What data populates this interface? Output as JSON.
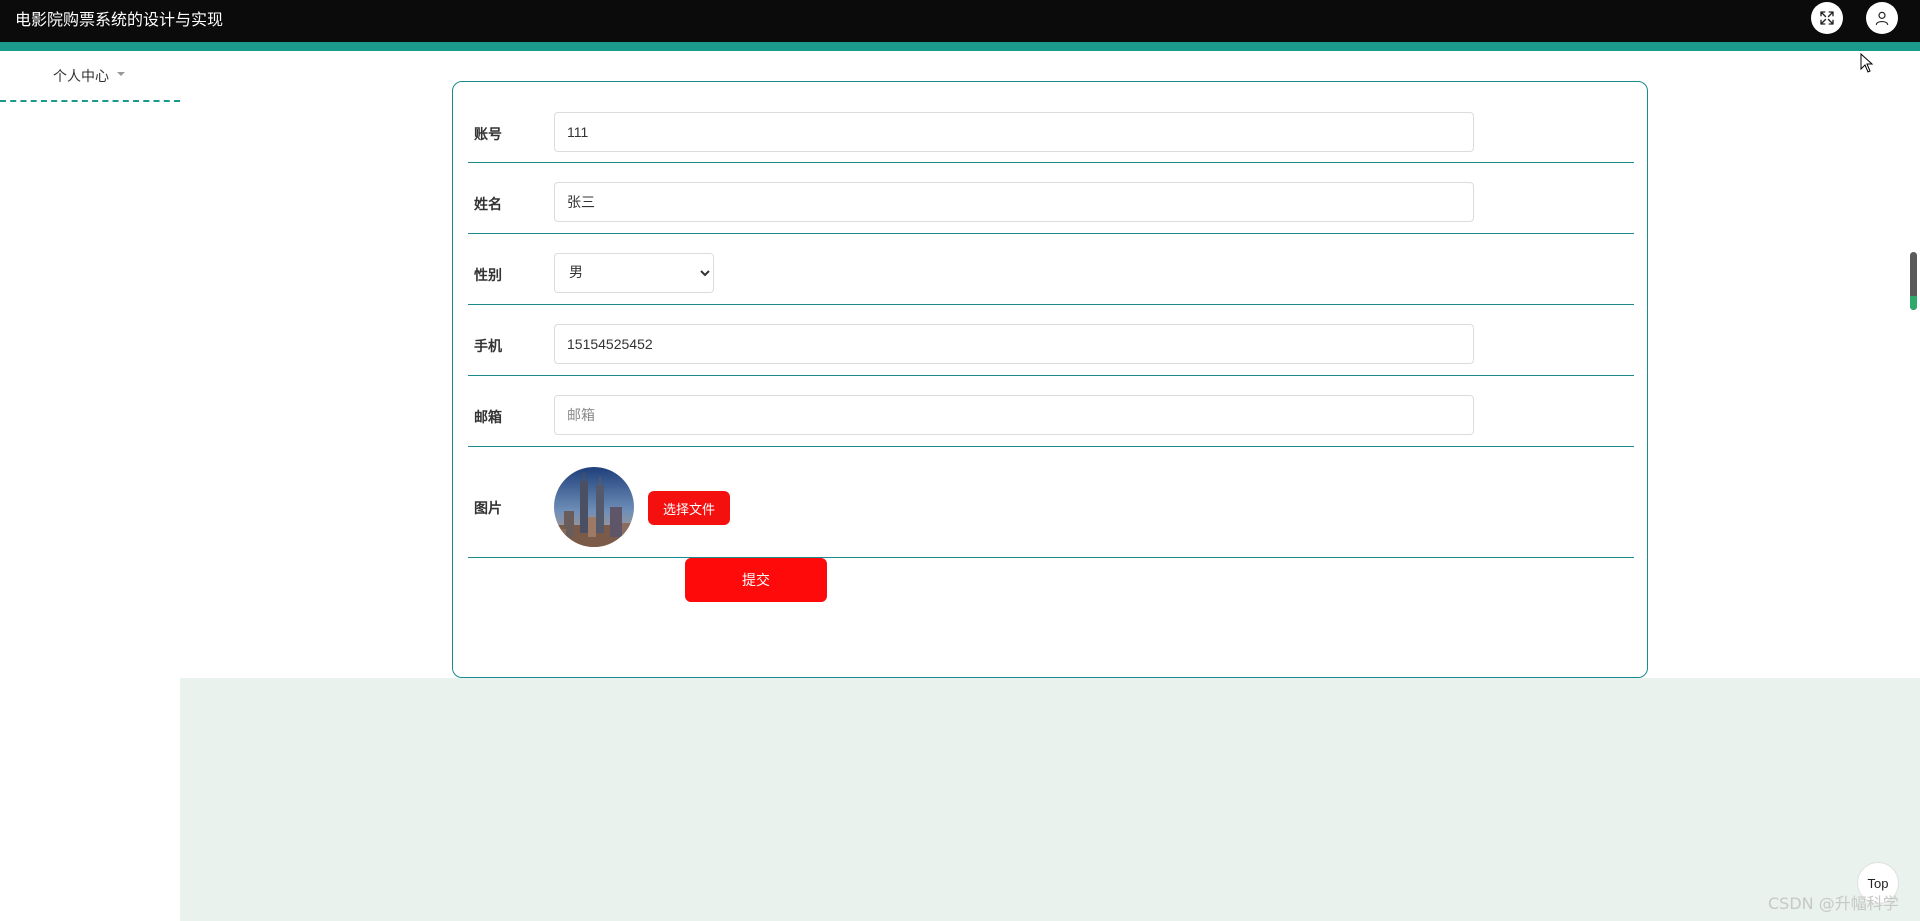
{
  "app": {
    "title": "电影院购票系统的设计与实现"
  },
  "header": {
    "icons": [
      "fullscreen-icon",
      "user-icon"
    ]
  },
  "sidebar": {
    "menu_label": "个人中心"
  },
  "form": {
    "account": {
      "label": "账号",
      "value": "111"
    },
    "name": {
      "label": "姓名",
      "value": "张三"
    },
    "gender": {
      "label": "性别",
      "value": "男",
      "options": [
        "男"
      ]
    },
    "phone": {
      "label": "手机",
      "value": "15154525452"
    },
    "email": {
      "label": "邮箱",
      "value": "",
      "placeholder": "邮箱"
    },
    "image": {
      "label": "图片",
      "button_label": "选择文件"
    },
    "submit_label": "提交"
  },
  "floating": {
    "top_label": "Top",
    "watermark": "CSDN @升幅科学"
  },
  "colors": {
    "accent": "#1b9a8c",
    "button_red": "#f51010",
    "content_bg": "#e9f2ec"
  }
}
